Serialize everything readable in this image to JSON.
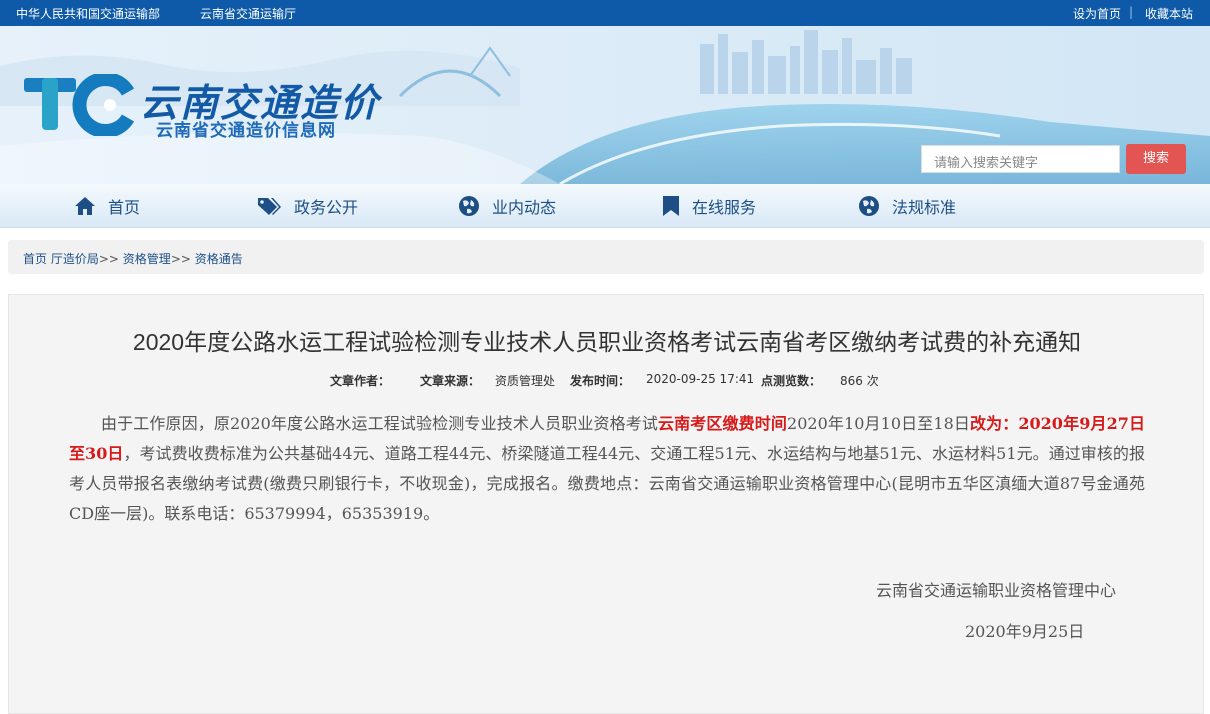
{
  "topbar": {
    "left_links": [
      "中华人民共和国交通运输部",
      "云南省交通运输厅"
    ],
    "right_links": [
      "设为首页",
      "收藏本站"
    ]
  },
  "header": {
    "logo_title": "云南交通造价",
    "logo_subtitle": "云南省交通造价信息网",
    "search_placeholder": "请输入搜索关键字",
    "search_button": "搜索"
  },
  "nav": {
    "items": [
      {
        "label": "首页",
        "icon": "home-icon"
      },
      {
        "label": "政务公开",
        "icon": "tags-icon"
      },
      {
        "label": "业内动态",
        "icon": "globe-icon"
      },
      {
        "label": "在线服务",
        "icon": "bookmark-icon"
      },
      {
        "label": "法规标准",
        "icon": "globe-icon"
      }
    ]
  },
  "breadcrumb": {
    "items": [
      "首页",
      "厅造价局",
      "资格管理",
      "资格通告"
    ],
    "separator": ">>"
  },
  "article": {
    "title": "2020年度公路水运工程试验检测专业技术人员职业资格考试云南省考区缴纳考试费的补充通知",
    "meta": {
      "author_label": "文章作者：",
      "author_value": "",
      "source_label": "文章来源：",
      "source_value": "资质管理处",
      "time_label": "发布时间：",
      "time_value": "2020-09-25 17:41",
      "views_label": "点测览数：",
      "views_value": "866 次"
    },
    "body": {
      "part1": "由于工作原因，原2020年度公路水运工程试验检测专业技术人员职业资格考试",
      "red1": "云南考区缴费时间",
      "part2": "2020年10月10日至18日",
      "red2": "改为：2020年9月27日至30日",
      "part3": "，考试费收费标准为公共基础44元、道路工程44元、桥梁隧道工程44元、交通工程51元、水运结构与地基51元、水运材料51元。通过审核的报考人员带报名表缴纳考试费(缴费只刷银行卡，不收现金)，完成报名。缴费地点：云南省交通运输职业资格管理中心(昆明市五华区滇缅大道87号金通苑CD座一层)。联系电话：65379994，65353919。"
    },
    "signature": "云南省交通运输职业资格管理中心",
    "date": "2020年9月25日"
  },
  "colors": {
    "topbar": "#0e5aa8",
    "accent_red": "#d61a1a",
    "search_button": "#e25552",
    "nav_text": "#1d4f86"
  }
}
